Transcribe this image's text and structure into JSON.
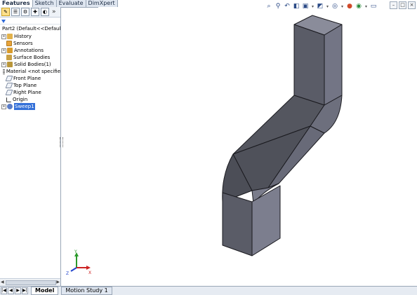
{
  "tabs": {
    "features": "Features",
    "sketch": "Sketch",
    "evaluate": "Evaluate",
    "dimxpert": "DimXpert"
  },
  "panel": {
    "more": "»"
  },
  "tree": {
    "root": "Part2  (Default<<Default",
    "items": [
      {
        "label": "History"
      },
      {
        "label": "Sensors"
      },
      {
        "label": "Annotations"
      },
      {
        "label": "Surface Bodies"
      },
      {
        "label": "Solid Bodies(1)"
      },
      {
        "label": "Material <not specifie"
      },
      {
        "label": "Front Plane"
      },
      {
        "label": "Top Plane"
      },
      {
        "label": "Right Plane"
      },
      {
        "label": "Origin"
      },
      {
        "label": "Sweep1"
      }
    ]
  },
  "bottom": {
    "model": "Model",
    "motion": "Motion Study 1"
  },
  "triad": {
    "x": "X",
    "y": "Y",
    "z": "Z"
  },
  "colors": {
    "accent": "#3470d8",
    "part_face_front": "#5a5c67",
    "part_face_side": "#737585",
    "part_face_top": "#8a8c9a",
    "edge": "#1a1a1f"
  },
  "icons": {
    "view_toolbar": [
      "zoom-to-fit-icon",
      "zoom-to-area-icon",
      "previous-view-icon",
      "section-view-icon",
      "view-orientation-icon",
      "display-style-icon",
      "hide-show-icon",
      "edit-appearance-icon",
      "apply-scene-icon",
      "view-settings-icon"
    ]
  }
}
